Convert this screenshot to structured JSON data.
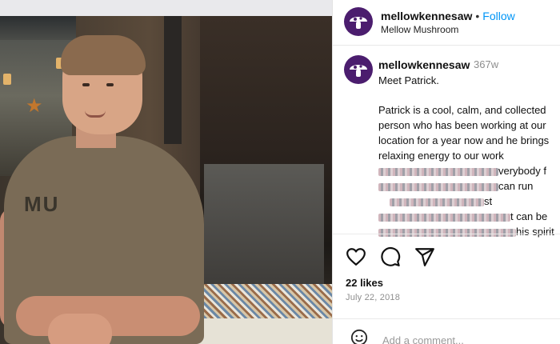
{
  "post": {
    "image_alt": "Photo of Patrick leaning on the counter inside the restaurant",
    "shirt_text": "MU"
  },
  "header": {
    "username": "mellowkennesaw",
    "separator": "•",
    "follow_label": "Follow",
    "subtitle": "Mellow Mushroom"
  },
  "caption": {
    "username": "mellowkennesaw",
    "time_ago": "367w",
    "greeting": "Meet Patrick.",
    "lines": [
      "Patrick is a cool, calm, and collected",
      "person who has been working at our",
      "location for a year now and he brings",
      "relaxing energy to our work"
    ],
    "partial_1": "verybody f",
    "partial_2": "can run",
    "partial_3": "st",
    "partial_4": "t can be",
    "partial_5": "his spirit"
  },
  "actions": {
    "like_icon": "heart-icon",
    "comment_icon": "comment-icon",
    "share_icon": "share-icon"
  },
  "stats": {
    "likes": "22 likes",
    "date": "July 22, 2018"
  },
  "comment": {
    "placeholder": "Add a comment...",
    "emoji_icon": "emoji-icon"
  },
  "colors": {
    "accent": "#0095f6",
    "avatar_bg": "#4b1d6e"
  }
}
